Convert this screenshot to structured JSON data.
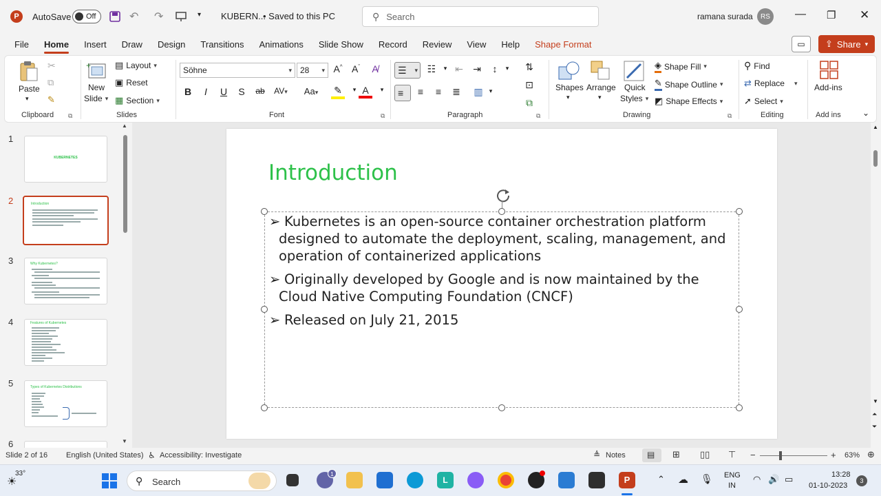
{
  "titlebar": {
    "autosave_label": "AutoSave",
    "autosave_state": "Off",
    "filename": "KUBERN...",
    "save_status": "• Saved to this PC",
    "search_placeholder": "Search",
    "user_name": "ramana surada",
    "user_initials": "RS",
    "app_logo": "P"
  },
  "menu": {
    "tabs": [
      "File",
      "Insert",
      "Draw",
      "Design",
      "Transitions",
      "Animations",
      "Slide Show",
      "Record",
      "Review",
      "View",
      "Help"
    ],
    "active_tab": "Home",
    "contextual_tab": "Shape Format",
    "share_label": "Share"
  },
  "ribbon": {
    "clipboard": {
      "paste": "Paste",
      "label": "Clipboard"
    },
    "slides": {
      "new_slide": "New",
      "new_slide2": "Slide",
      "layout": "Layout",
      "reset": "Reset",
      "section": "Section",
      "label": "Slides"
    },
    "font": {
      "font_name": "Söhne",
      "font_size": "28",
      "bold": "B",
      "italic": "I",
      "underline": "U",
      "shadow": "S",
      "strike": "ab",
      "spacing": "AV",
      "case": "Aa",
      "label": "Font"
    },
    "paragraph": {
      "label": "Paragraph"
    },
    "drawing": {
      "shapes": "Shapes",
      "arrange": "Arrange",
      "quick": "Quick",
      "styles": "Styles",
      "shape_fill": "Shape Fill",
      "shape_outline": "Shape Outline",
      "shape_effects": "Shape Effects",
      "label": "Drawing"
    },
    "editing": {
      "find": "Find",
      "replace": "Replace",
      "select": "Select",
      "label": "Editing"
    },
    "addins": {
      "addins": "Add-ins",
      "label": "Add ins"
    }
  },
  "thumbnails": [
    {
      "num": "1",
      "title": "KUBERNETES"
    },
    {
      "num": "2",
      "title": "Introduction"
    },
    {
      "num": "3",
      "title": "Why Kubernetes?"
    },
    {
      "num": "4",
      "title": "Features of Kubernetes"
    },
    {
      "num": "5",
      "title": "Types of Kubernetes Distributions"
    },
    {
      "num": "6",
      "title": ""
    }
  ],
  "slide": {
    "title": "Introduction",
    "bullets": [
      "Kubernetes is an open-source container orchestration platform designed to automate the deployment, scaling, management, and operation of containerized applications",
      "Originally developed by Google and is now maintained by the Cloud Native Computing Foundation (CNCF)",
      "Released on July 21, 2015"
    ],
    "title_color": "#2ec14a"
  },
  "statusbar": {
    "slide_info": "Slide 2 of 16",
    "language": "English (United States)",
    "accessibility": "Accessibility: Investigate",
    "notes": "Notes",
    "zoom": "63%"
  },
  "taskbar": {
    "weather": "33°",
    "search": "Search",
    "lang1": "ENG",
    "lang2": "IN",
    "time": "13:28",
    "date": "01-10-2023",
    "notif_count": "3",
    "chat_badge": "1"
  },
  "colors": {
    "accent": "#c43e1c",
    "title_green": "#2ec14a"
  }
}
